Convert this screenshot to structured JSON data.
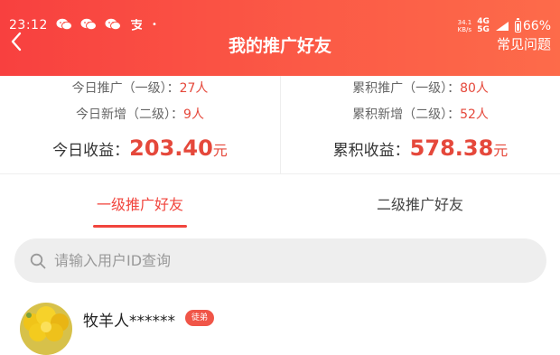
{
  "status_bar": {
    "time": "23:12",
    "app_icons": [
      "wechat-icon",
      "wechat-icon",
      "wechat-icon",
      "alipay-icon"
    ],
    "dot": "•",
    "net_speed": "34.1",
    "net_unit": "KB/s",
    "net_4g": "4G",
    "net_5g": "5G",
    "battery": "66%"
  },
  "header": {
    "title": "我的推广好友",
    "right_link": "常见问题"
  },
  "stats": {
    "left": {
      "line1": {
        "label": "今日推广（一级）：",
        "value": "27人"
      },
      "line2": {
        "label": "今日新增（二级）：",
        "value": "9人"
      },
      "earnings": {
        "label": "今日收益：",
        "amount": "203.40",
        "unit": "元"
      }
    },
    "right": {
      "line1": {
        "label": "累积推广（一级）：",
        "value": "80人"
      },
      "line2": {
        "label": "累积新增（二级）：",
        "value": "52人"
      },
      "earnings": {
        "label": "累积收益：",
        "amount": "578.38",
        "unit": "元"
      }
    }
  },
  "tabs": [
    {
      "label": "一级推广好友",
      "active": true
    },
    {
      "label": "二级推广好友",
      "active": false
    }
  ],
  "search": {
    "placeholder": "请输入用户ID查询",
    "value": ""
  },
  "friends": [
    {
      "name": "牧羊人******",
      "badge": "徒弟"
    }
  ],
  "colors": {
    "header_start": "#f8403f",
    "header_end": "#fd6b4a",
    "accent": "#f1453d",
    "amount": "#e5483b"
  }
}
